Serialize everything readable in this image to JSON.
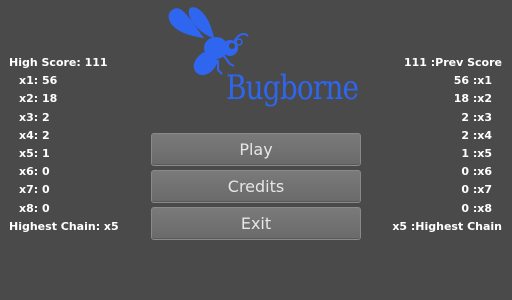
{
  "game": {
    "title": "Bugborne",
    "logo_icon": "bee-icon",
    "logo_color": "#2f66f0",
    "background_color": "#4a4a4a"
  },
  "left_stats": {
    "high_score_label": "High Score: 111",
    "rows": [
      "x1: 56",
      "x2: 18",
      "x3: 2",
      "x4: 2",
      "x5: 1",
      "x6: 0",
      "x7: 0",
      "x8: 0"
    ],
    "highest_chain_label": "Highest Chain: x5"
  },
  "right_stats": {
    "prev_score_label": "111 :Prev Score",
    "rows": [
      "56 :x1",
      "18 :x2",
      "2 :x3",
      "2 :x4",
      "1 :x5",
      "0 :x6",
      "0 :x7",
      "0 :x8"
    ],
    "highest_chain_label": "x5 :Highest Chain"
  },
  "menu": {
    "play_label": "Play",
    "credits_label": "Credits",
    "exit_label": "Exit"
  }
}
